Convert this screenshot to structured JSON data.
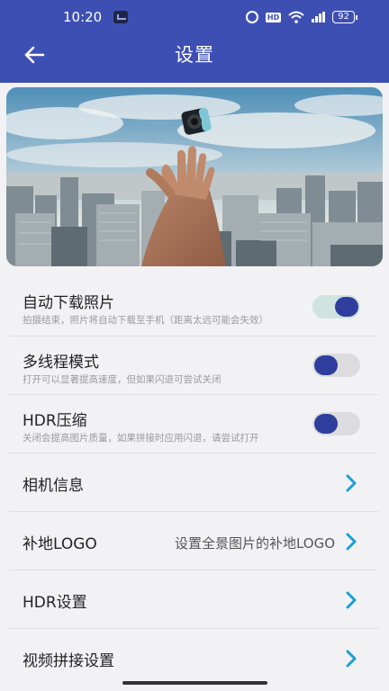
{
  "status_bar": {
    "time": "10:20",
    "battery": "92"
  },
  "header": {
    "title": "设置",
    "back_icon": "arrow-left-icon"
  },
  "banner": {
    "image": "hand tossing 360 camera over city skyline"
  },
  "settings": [
    {
      "title": "自动下载照片",
      "subtitle": "拍摄结束，照片将自动下载至手机（距离太远可能会失效）",
      "toggle": true
    },
    {
      "title": "多线程模式",
      "subtitle": "打开可以显著提高速度，但如果闪退可尝试关闭",
      "toggle": false
    },
    {
      "title": "HDR压缩",
      "subtitle": "关闭会提高图片质量，如果拼接时应用闪退，请尝试打开",
      "toggle": false
    },
    {
      "title": "相机信息"
    },
    {
      "title": "补地LOGO",
      "value": "设置全景图片的补地LOGO"
    },
    {
      "title": "HDR设置"
    },
    {
      "title": "视频拼接设置"
    }
  ],
  "colors": {
    "header": "#3e4fb4",
    "toggle_knob": "#2f3e9c",
    "chevron": "#1a9fd6"
  }
}
